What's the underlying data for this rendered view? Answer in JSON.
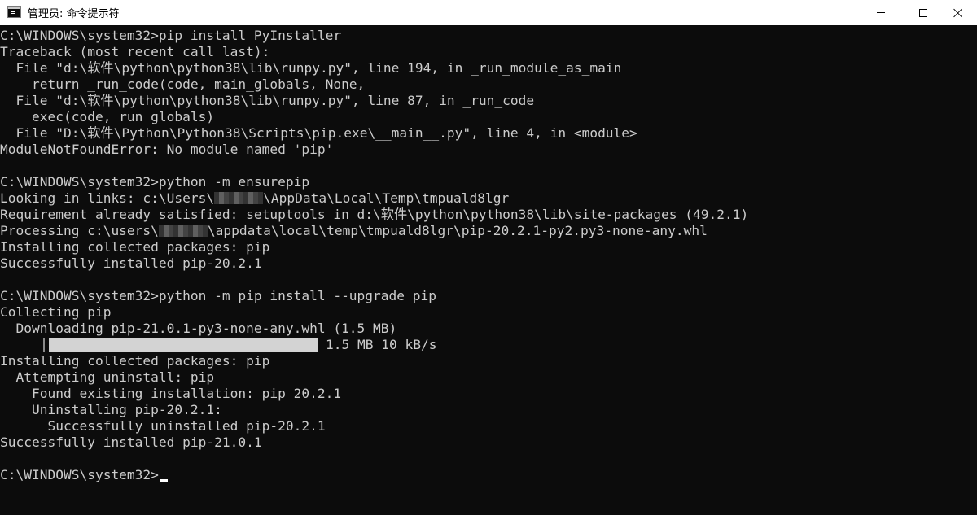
{
  "window": {
    "title": "管理员: 命令提示符"
  },
  "console": {
    "lines": [
      "C:\\WINDOWS\\system32>pip install PyInstaller",
      "Traceback (most recent call last):",
      "  File \"d:\\软件\\python\\python38\\lib\\runpy.py\", line 194, in _run_module_as_main",
      "    return _run_code(code, main_globals, None,",
      "  File \"d:\\软件\\python\\python38\\lib\\runpy.py\", line 87, in _run_code",
      "    exec(code, run_globals)",
      "  File \"D:\\软件\\Python\\Python38\\Scripts\\pip.exe\\__main__.py\", line 4, in <module>",
      "ModuleNotFoundError: No module named 'pip'",
      "",
      "C:\\WINDOWS\\system32>python -m ensurepip"
    ],
    "looking_prefix": "Looking in links: c:\\Users\\",
    "looking_suffix": "\\AppData\\Local\\Temp\\tmpuald8lgr",
    "requirement_line": "Requirement already satisfied: setuptools in d:\\软件\\python\\python38\\lib\\site-packages (49.2.1)",
    "processing_prefix": "Processing c:\\users\\",
    "processing_suffix": "\\appdata\\local\\temp\\tmpuald8lgr\\pip-20.2.1-py2.py3-none-any.whl",
    "lines_after": [
      "Installing collected packages: pip",
      "Successfully installed pip-20.2.1",
      "",
      "C:\\WINDOWS\\system32>python -m pip install --upgrade pip",
      "Collecting pip",
      "  Downloading pip-21.0.1-py3-none-any.whl (1.5 MB)"
    ],
    "progress": {
      "fraction": 1.0,
      "text": "1.5 MB 10 kB/s"
    },
    "lines_end": [
      "Installing collected packages: pip",
      "  Attempting uninstall: pip",
      "    Found existing installation: pip 20.2.1",
      "    Uninstalling pip-20.2.1:",
      "      Successfully uninstalled pip-20.2.1",
      "Successfully installed pip-21.0.1",
      ""
    ],
    "prompt": "C:\\WINDOWS\\system32>"
  },
  "colors": {
    "background": "#0c0c0c",
    "text": "#cccccc",
    "progress_fill": "#d3d3d3"
  },
  "icons": {
    "app": "cmd-icon",
    "minimize": "minimize-icon",
    "maximize": "maximize-icon",
    "close": "close-icon"
  }
}
